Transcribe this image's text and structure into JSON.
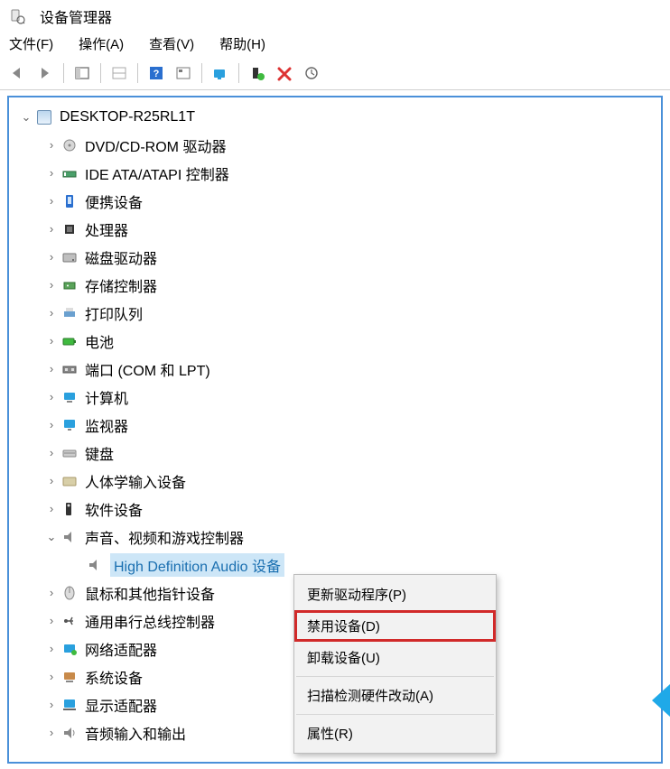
{
  "window": {
    "title": "设备管理器"
  },
  "menu": {
    "file": "文件(F)",
    "action": "操作(A)",
    "view": "查看(V)",
    "help": "帮助(H)"
  },
  "tree": {
    "root": "DESKTOP-R25RL1T",
    "nodes": [
      {
        "label": "DVD/CD-ROM 驱动器",
        "icon": "disc"
      },
      {
        "label": "IDE ATA/ATAPI 控制器",
        "icon": "ide"
      },
      {
        "label": "便携设备",
        "icon": "portable"
      },
      {
        "label": "处理器",
        "icon": "cpu"
      },
      {
        "label": "磁盘驱动器",
        "icon": "disk"
      },
      {
        "label": "存储控制器",
        "icon": "storage"
      },
      {
        "label": "打印队列",
        "icon": "printer"
      },
      {
        "label": "电池",
        "icon": "battery"
      },
      {
        "label": "端口 (COM 和 LPT)",
        "icon": "port"
      },
      {
        "label": "计算机",
        "icon": "computer"
      },
      {
        "label": "监视器",
        "icon": "monitor"
      },
      {
        "label": "键盘",
        "icon": "keyboard"
      },
      {
        "label": "人体学输入设备",
        "icon": "hid"
      },
      {
        "label": "软件设备",
        "icon": "software"
      },
      {
        "label": "声音、视频和游戏控制器",
        "icon": "sound",
        "expanded": true
      },
      {
        "label": "鼠标和其他指针设备",
        "icon": "mouse"
      },
      {
        "label": "通用串行总线控制器",
        "icon": "usb"
      },
      {
        "label": "网络适配器",
        "icon": "network"
      },
      {
        "label": "系统设备",
        "icon": "system"
      },
      {
        "label": "显示适配器",
        "icon": "display"
      },
      {
        "label": "音频输入和输出",
        "icon": "audio"
      }
    ],
    "sound_child": "High Definition Audio 设备"
  },
  "context_menu": {
    "update": "更新驱动程序(P)",
    "disable": "禁用设备(D)",
    "uninstall": "卸载设备(U)",
    "scan": "扫描检测硬件改动(A)",
    "properties": "属性(R)"
  }
}
